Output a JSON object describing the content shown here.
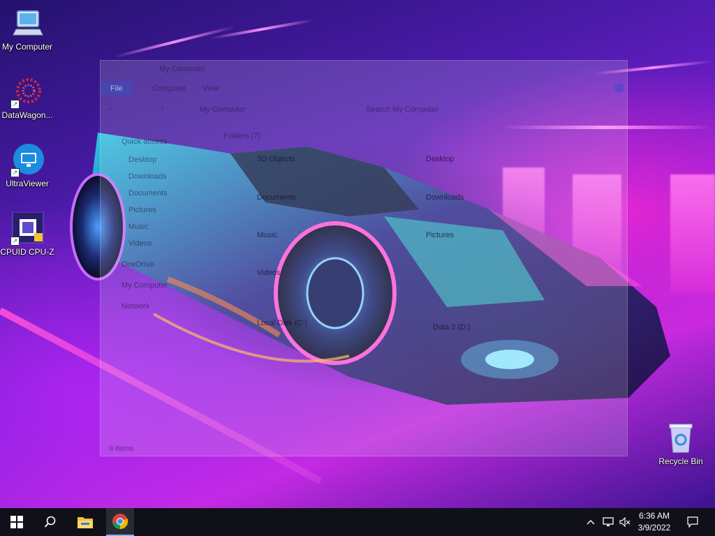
{
  "desktop": {
    "icons": [
      {
        "label": "My Computer",
        "icon": "computer-icon"
      },
      {
        "label": "DataWagon...",
        "icon": "datawagon-icon"
      },
      {
        "label": "UltraViewer",
        "icon": "ultraviewer-icon"
      },
      {
        "label": "CPUID CPU-Z",
        "icon": "cpuz-icon"
      },
      {
        "label": "Recycle Bin",
        "icon": "recycle-bin-icon"
      }
    ]
  },
  "explorer": {
    "title": "My Computer",
    "tabs": [
      "File",
      "Computer",
      "View"
    ],
    "address": "My Computer",
    "search_placeholder": "Search My Computer",
    "section_header": "Folders (7)",
    "nav_items": [
      "Quick access",
      "Desktop",
      "Downloads",
      "Documents",
      "Pictures",
      "Music",
      "Videos",
      "OneDrive",
      "My Computer",
      "Network"
    ],
    "folders": [
      "3D Objects",
      "Desktop",
      "Documents",
      "Downloads",
      "Music",
      "Pictures",
      "Videos"
    ],
    "drives": [
      "Local Disk (C:)",
      "Data 2 (D:)"
    ],
    "status": "9 items"
  },
  "taskbar": {
    "start_icon": "windows-logo-icon",
    "search_icon": "search-icon",
    "pinned": [
      "file-explorer-icon",
      "chrome-icon"
    ],
    "tray": [
      "chevron-up-icon",
      "network-icon",
      "volume-muted-icon"
    ],
    "time": "6:36 AM",
    "date": "3/9/2022",
    "notification_icon": "action-center-icon"
  }
}
